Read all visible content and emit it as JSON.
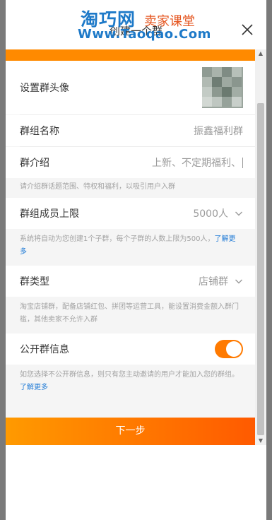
{
  "watermark": {
    "brand": "淘巧网",
    "brand_suffix": "卖家课堂",
    "url": "Www.Taoqao.Com"
  },
  "header": {
    "title": "创建一个群"
  },
  "form": {
    "avatar_label": "设置群头像",
    "name_label": "群组名称",
    "name_value": "振鑫福利群",
    "intro_label": "群介绍",
    "intro_placeholder": "上新、不定期福利、",
    "intro_note": "请介绍群话题范围、特权和福利，以吸引用户入群",
    "limit_label": "群组成员上限",
    "limit_value": "5000人",
    "limit_note": "系统将自动为您创建1个子群，每个子群的人数上限为500人，",
    "limit_note_link": "了解更多",
    "type_label": "群类型",
    "type_value": "店铺群",
    "type_note": "淘宝店铺群，配备店铺红包、拼团等运营工具，能设置消费金额入群门槛，其他卖家不允许入群",
    "public_label": "公开群信息",
    "public_enabled": true,
    "public_note": "如您选择不公开群信息，则只有您主动邀请的用户才能加入您的群组。",
    "public_note_link": "了解更多"
  },
  "actions": {
    "next_label": "下一步"
  },
  "colors": {
    "accent": "#ff7a00",
    "link": "#1f7ad6"
  },
  "icons": {
    "close": "close-icon",
    "chevron": "chevron-down-icon"
  }
}
